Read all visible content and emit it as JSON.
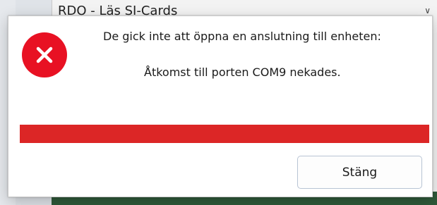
{
  "background_window": {
    "title": "RDO - Läs SI-Cards"
  },
  "dialog": {
    "icon": "error-icon",
    "message_line1": "De gick inte att öppna en anslutning till enheten:",
    "message_line2": "Åtkomst till porten COM9 nekades.",
    "error_bar_color": "#dc2626",
    "close_button_label": "Stäng"
  }
}
